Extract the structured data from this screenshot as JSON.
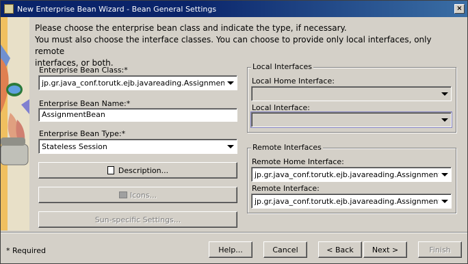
{
  "window": {
    "title": "New Enterprise Bean Wizard - Bean General Settings",
    "close_glyph": "×"
  },
  "instructions": {
    "line1": "Please choose the enterprise bean class and indicate the type, if necessary.",
    "line2": "You must also choose the interface classes.  You can choose to provide only local interfaces, only remote",
    "line3": "interfaces, or both."
  },
  "bean_class": {
    "label": "Enterprise Bean Class:*",
    "value": "jp.gr.java_conf.torutk.ejb.javareading.AssignmentBean"
  },
  "bean_name": {
    "label": "Enterprise Bean Name:*",
    "value": "AssignmentBean"
  },
  "bean_type": {
    "label": "Enterprise Bean Type:*",
    "value": "Stateless Session"
  },
  "buttons_left": {
    "description": "Description...",
    "icons": "Icons...",
    "sun_specific": "Sun-specific Settings..."
  },
  "local_interfaces": {
    "legend": "Local Interfaces",
    "home_label": "Local Home Interface:",
    "home_value": "",
    "interface_label": "Local Interface:",
    "interface_value": ""
  },
  "remote_interfaces": {
    "legend": "Remote Interfaces",
    "home_label": "Remote Home Interface:",
    "home_value": "jp.gr.java_conf.torutk.ejb.javareading.AssignmentHome",
    "interface_label": "Remote Interface:",
    "interface_value": "jp.gr.java_conf.torutk.ejb.javareading.Assignment"
  },
  "footer": {
    "required_note": "* Required",
    "help": "Help...",
    "cancel": "Cancel",
    "back": "< Back",
    "next": "Next >",
    "finish": "Finish"
  }
}
